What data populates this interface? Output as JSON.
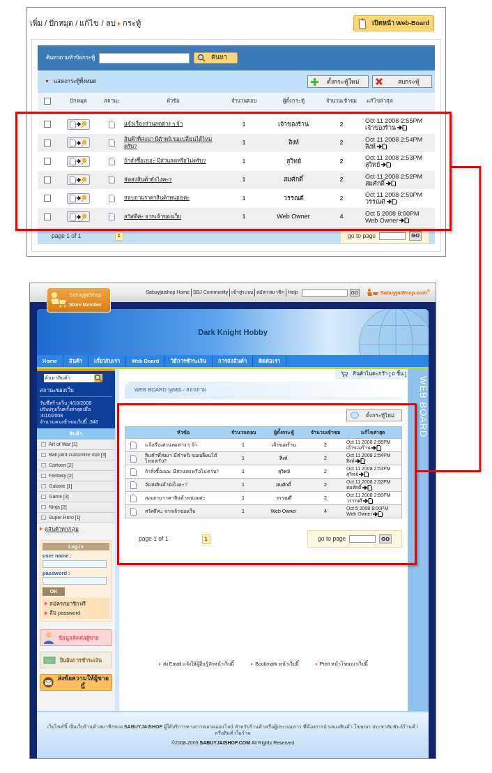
{
  "admin": {
    "breadcrumb": {
      "path": "เพิ่ม / ปักหมุด / แก้ไข / ลบ",
      "current": "กระทู้"
    },
    "open_board_button": "เปิดหน้า Web-Board",
    "search": {
      "label": "ค้นหาตามหัวข้อกระทู้",
      "button": "ค้นหา"
    },
    "show_all": "แสดงกระทู้ทั้งหมด",
    "new_button": "ตั้งกระทู้ใหม่",
    "delete_button": "ลบกระทู้",
    "select_all": {
      "checked": false
    },
    "columns": [
      "ปักหมุด",
      "สถานะ",
      "หัวข้อ",
      "จำนวนตอบ",
      "ผู้ตั้งกระทู้",
      "จำนวนเข้าชม",
      "แก้ไขล่าสุด"
    ],
    "rows": [
      {
        "checked": false,
        "subject": "แจ้งเรื่องส่วนลดต่าง ๆ จ้า",
        "replies": "1",
        "author": "เจ้าของร้าน",
        "views": "2",
        "date": "Oct 11 2008 2:55PM",
        "editor": "เจ้าของร้าน"
      },
      {
        "checked": false,
        "subject": "สินค้าที่ส่งมา มีตำหนิ ขอเปลี่ยนได้ไหมครับ?",
        "replies": "1",
        "author": "สิงห์",
        "views": "2",
        "date": "Oct 11 2008 2:54PM",
        "editor": "สิงห์"
      },
      {
        "checked": false,
        "subject": "ถ้าสั่งซื้อเยอะ มีส่วนลดหรือไม่ครับ?",
        "replies": "1",
        "author": "สุวิทย์",
        "views": "2",
        "date": "Oct 11 2008 2:53PM",
        "editor": "สุวิทย์"
      },
      {
        "checked": false,
        "subject": "จัดส่งสินค้ายังไงคะ?",
        "replies": "1",
        "author": "สมศักดิ์",
        "views": "2",
        "date": "Oct 11 2008 2:52PM",
        "editor": "สมศักดิ์"
      },
      {
        "checked": false,
        "subject": "สอบถามราคาสินค้าหน่อยค่ะ",
        "replies": "1",
        "author": "วรรณดี",
        "views": "2",
        "date": "Oct 11 2008 2:50PM",
        "editor": "วรรณดี"
      },
      {
        "checked": false,
        "subject": "สวัสดีค่ะ จากเจ้าของเว็บ",
        "replies": "1",
        "author": "Web Owner",
        "views": "4",
        "date": "Oct 5 2008 8:00PM",
        "editor": "Web Owner"
      }
    ],
    "pager": {
      "label": "page 1 of 1",
      "pages": [
        {
          "label": "1",
          "selected": true
        }
      ],
      "goto": "go to page",
      "go": "GO"
    }
  },
  "store": {
    "top_links": [
      "Sabuyjaishop Home",
      "SBJ Community",
      "เข้าสู่ระบบ",
      "สมัครสมาชิก",
      "Help"
    ],
    "top_go": "GO",
    "logo": "SabuyjaiShop.com$^{®}$",
    "member_badge": {
      "brand": "SabuyjaiShop",
      "label": "Store Member"
    },
    "title": "Dark Knight Hobby",
    "nav": [
      "Home",
      "สินค้า",
      "เกี่ยวกับเรา",
      "Web Board",
      "วิธีการชำระเงิน",
      "การส่งสินค้า",
      "ติดต่อเรา"
    ],
    "product_search": {
      "placeholder": "ค้นหาสินค้า"
    },
    "stats": {
      "title": "สถานะของเว็บ",
      "lines": [
        "วันที่สร้างเว็บ :4/10/2008",
        "ปรับปรุงเว็บครั้งล่าสุดเมื่อ :4/10/2008",
        "จำนวนคนเข้าชมเว็บนี้ :348"
      ]
    },
    "categories_title": "สินค้า",
    "categories": [
      "Art of War [1]",
      "Ball joint customize doll [3]",
      "Cartoon [2]",
      "Fantasy [2]",
      "Galaxie [1]",
      "Game [3]",
      "Ninja [2]",
      "Super Hero [1]"
    ],
    "all_categories": "ดูสินค้าทุกกลุ่ม",
    "login": {
      "title": "Log-in",
      "user_label": "user name :",
      "password_label": "password :",
      "ok": "OK",
      "links": [
        "สมัครสมาชิกฟรี",
        "ลืม password"
      ]
    },
    "banners": [
      {
        "kind": "contact",
        "label": "ข้อมูลติดต่อผู้ขาย"
      },
      {
        "kind": "payment",
        "label": "ยืนยันการชำระเงิน"
      },
      {
        "kind": "message",
        "label": "ส่งข้อความให้ผู้ขายนี้"
      }
    ],
    "cart": "สินค้าในตะกร้า [ 0 ชิ้น ]",
    "board_title": "WEB BOARD พูดคุย - สอบถาม",
    "side_label": "WEB BOARD",
    "new_button": "ตั้งกระทู้ใหม่",
    "columns": [
      "หัวข้อ",
      "จำนวนตอบ",
      "ผู้ตั้งกระทู้",
      "จำนวนเข้าชม",
      "แก้ไขล่าสุด"
    ],
    "rows": [
      {
        "subject": "แจ้งเรื่องส่วนลดต่าง ๆ จ้า",
        "replies": "1",
        "author": "เจ้าของร้าน",
        "views": "2",
        "date": "Oct 11 2008 2:55PM",
        "editor": "เจ้าของร้าน"
      },
      {
        "subject": "สินค้าที่ส่งมา มีตำหนิ ขอเปลี่ยนได้ไหมครับ?",
        "replies": "1",
        "author": "สิงห์",
        "views": "2",
        "date": "Oct 11 2008 2:54PM",
        "editor": "สิงห์"
      },
      {
        "subject": "ถ้าสั่งซื้อเยอะ มีส่วนลดหรือไม่ครับ?",
        "replies": "1",
        "author": "สุวิทย์",
        "views": "2",
        "date": "Oct 11 2008 2:53PM",
        "editor": "สุวิทย์"
      },
      {
        "subject": "จัดส่งสินค้ายังไงคะ?",
        "replies": "1",
        "author": "สมศักดิ์",
        "views": "2",
        "date": "Oct 11 2008 2:52PM",
        "editor": "สมศักดิ์"
      },
      {
        "subject": "สอบถามราคาสินค้าหน่อยค่ะ",
        "replies": "1",
        "author": "วรรณดี",
        "views": "2",
        "date": "Oct 11 2008 2:50PM",
        "editor": "วรรณดี"
      },
      {
        "subject": "สวัสดีค่ะ จากเจ้าของเว็บ",
        "replies": "1",
        "author": "Web Owner",
        "views": "4",
        "date": "Oct 5 2008 8:00PM",
        "editor": "Web Owner"
      }
    ],
    "pager": {
      "label": "page 1 of 1",
      "pages": [
        {
          "label": "1",
          "selected": true
        }
      ],
      "goto": "go to page",
      "go": "GO"
    },
    "footer_links": [
      "ส่ง Email แจ้งให้ผู้อื่นรู้จักหน้าเว็บนี้",
      "Bookmark หน้าเว็บนี้",
      "Print หน้าโฆษณาเว็บนี้"
    ],
    "footer_text": "เว็บไซต์นี้ เป็นเว็บร้านค้าสมาชิกของ **SABUYJAISHOP** ผู้ให้บริการทางการตลาดออนไลน์ สำหรับร้านค้าหรือผู้ประกอบการ ที่ต้องการนำเสนอสินค้า โฆษณา ประชาสัมพันธ์ร้านค้า หรือสินค้าในร้าน",
    "copyright": "©2008-2009 **SABUYJAISHOP.COM** All Rights Reserved"
  }
}
